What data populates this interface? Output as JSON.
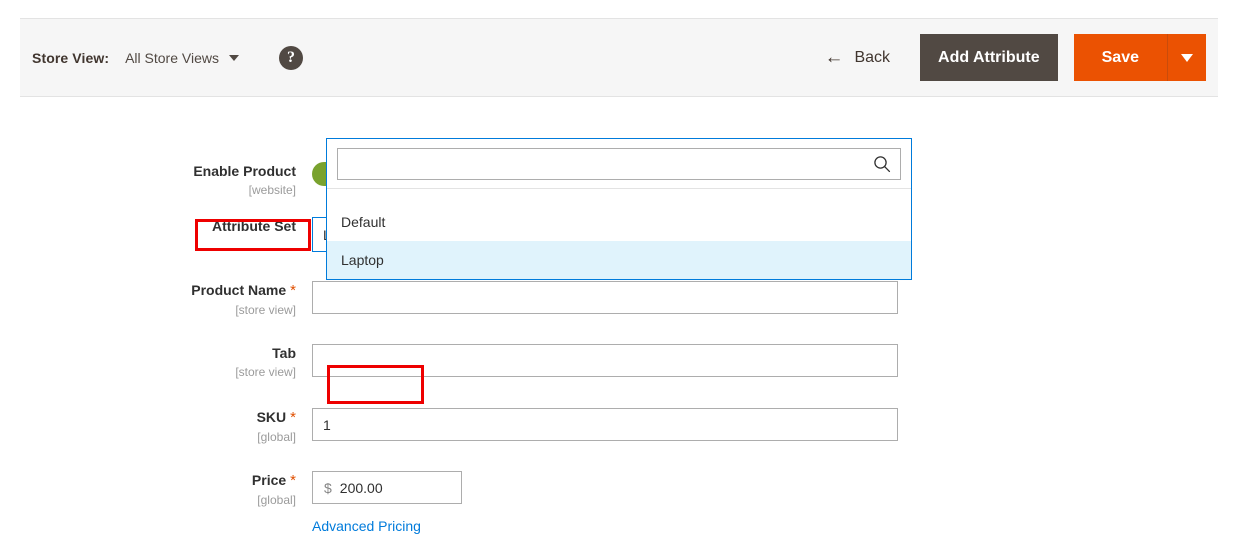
{
  "header": {
    "store_view_label": "Store View:",
    "store_view_value": "All Store Views",
    "help_icon": "help-circle-icon",
    "back_label": "Back",
    "back_icon": "arrow-left-icon",
    "add_attribute_label": "Add Attribute",
    "save_label": "Save",
    "save_menu_icon": "chevron-down-icon"
  },
  "form": {
    "enable_product": {
      "label": "Enable Product",
      "scope": "[website]",
      "toggle_state": "Yes"
    },
    "attribute_set": {
      "label": "Attribute Set",
      "value": "Laptop",
      "toggle_icon": "chevron-up-icon",
      "dropdown": {
        "search_value": "",
        "search_placeholder": "",
        "search_icon": "search-icon",
        "options": [
          {
            "label": "Default",
            "selected": false
          },
          {
            "label": "Laptop",
            "selected": true
          }
        ]
      }
    },
    "product_name": {
      "label": "Product Name",
      "required": "*",
      "scope": "[store view]",
      "value": ""
    },
    "tab": {
      "label": "Tab",
      "scope": "[store view]",
      "value": ""
    },
    "sku": {
      "label": "SKU",
      "required": "*",
      "scope": "[global]",
      "value": "1"
    },
    "price": {
      "label": "Price",
      "required": "*",
      "scope": "[global]",
      "currency": "$",
      "value": "200.00",
      "advanced_pricing_link": "Advanced Pricing"
    }
  },
  "colors": {
    "accent_orange": "#eb5202",
    "secondary_dark": "#514943",
    "focus_blue": "#007bdb",
    "toggle_green": "#79a22e",
    "annotation_red": "#ee0000",
    "option_highlight": "#e0f3fc"
  }
}
